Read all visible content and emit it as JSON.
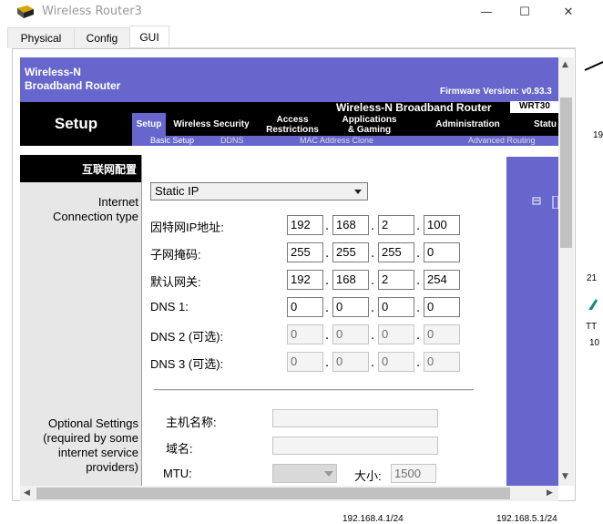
{
  "window": {
    "title": "Wireless Router3",
    "minimize": "—",
    "maximize": "☐",
    "close": "✕"
  },
  "tabs": [
    {
      "label": "Physical"
    },
    {
      "label": "Config"
    },
    {
      "label": "GUI",
      "active": true
    }
  ],
  "header": {
    "brand_line1": "Wireless-N",
    "brand_line2": "Broadband Router",
    "firmware": "Firmware Version: v0.93.3",
    "product": "Wireless-N Broadband Router",
    "model": "WRT30",
    "section": "Setup"
  },
  "nav": {
    "setup": "Setup",
    "wireless_security": "Wireless Security",
    "access_1": "Access",
    "access_2": "Restrictions",
    "apps_1": "Applications",
    "apps_2": "& Gaming",
    "administration": "Administration",
    "status": "Statu"
  },
  "subnav": {
    "basic_setup": "Basic Setup",
    "ddns": "DDNS",
    "mac_clone": "MAC Address Clone",
    "advanced_routing": "Advanced Routing"
  },
  "left": {
    "section_title": "互联网配置",
    "conn_type_1": "Internet",
    "conn_type_2": "Connection type",
    "optional_1": "Optional Settings",
    "optional_2": "(required by some",
    "optional_3": "internet service",
    "optional_4": "providers)"
  },
  "form": {
    "conn_type_value": "Static IP",
    "ip_label": "因特网IP地址:",
    "ip": [
      "192",
      "168",
      "2",
      "100"
    ],
    "mask_label": "子网掩码:",
    "mask": [
      "255",
      "255",
      "255",
      "0"
    ],
    "gw_label": "默认网关:",
    "gw": [
      "192",
      "168",
      "2",
      "254"
    ],
    "dns1_label": "DNS 1:",
    "dns1": [
      "0",
      "0",
      "0",
      "0"
    ],
    "dns2_label": "DNS 2 (可选):",
    "dns2": [
      "0",
      "0",
      "0",
      "0"
    ],
    "dns3_label": "DNS 3 (可选):",
    "dns3": [
      "0",
      "0",
      "0",
      "0"
    ],
    "hostname_label": "主机名称:",
    "hostname": "",
    "domain_label": "域名:",
    "domain": "",
    "mtu_label": "MTU:",
    "size_label": "大小:",
    "size_value": "1500"
  },
  "background": {
    "t1": "19",
    "t2": "21",
    "t3": "TT",
    "t4": "10",
    "bottom_left": "192.168.4.1/24",
    "bottom_right": "192.168.5.1/24"
  },
  "scroll": {
    "up": "▲",
    "down": "▼",
    "left": "◀",
    "right": "▶"
  }
}
